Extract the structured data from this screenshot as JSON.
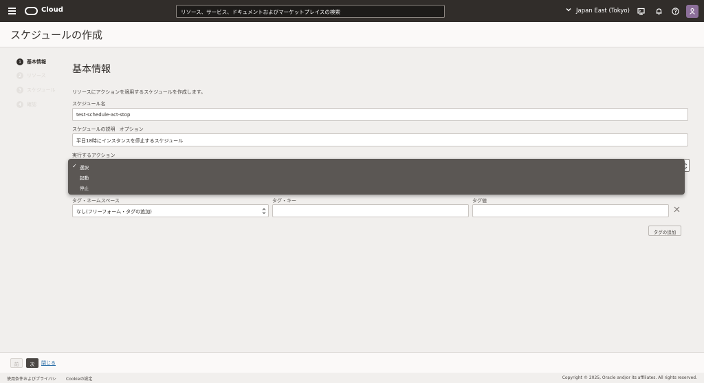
{
  "header": {
    "brand": "Cloud",
    "search_text": "リソース、サービス、ドキュメントおよびマーケットプレイスの検索",
    "region": "Japan East (Tokyo)"
  },
  "page": {
    "title": "スケジュールの作成"
  },
  "steps": [
    {
      "num": "1",
      "label": "基本情報",
      "active": true
    },
    {
      "num": "2",
      "label": "リソース",
      "active": false
    },
    {
      "num": "3",
      "label": "スケジュール",
      "active": false
    },
    {
      "num": "4",
      "label": "確認",
      "active": false
    }
  ],
  "form": {
    "section_title": "基本情報",
    "description": "リソースにアクションを適用するスケジュールを作成します。",
    "name_label": "スケジュール名",
    "name_value": "test-schedule-act-stop",
    "desc_label": "スケジュールの説明",
    "desc_optional": "オプション",
    "desc_value": "平日18時にインスタンスを停止するスケジュール",
    "action_label": "実行するアクション",
    "action_options": [
      "選択",
      "起動",
      "停止"
    ],
    "action_selected": "選択",
    "tag_namespace_label": "タグ・ネームスペース",
    "tag_namespace_value": "なし(フリーフォーム・タグの追加)",
    "tag_key_label": "タグ・キー",
    "tag_value_label": "タグ値",
    "add_tag_label": "タグの追加"
  },
  "footer": {
    "prev_label": "前",
    "next_label": "次",
    "close_label": "閉じる"
  },
  "legal": {
    "terms": "使用条件およびプライバシ",
    "cookies": "Cookieの設定",
    "copyright": "Copyright © 2025, Oracle and/or its affiliates. All rights reserved."
  }
}
